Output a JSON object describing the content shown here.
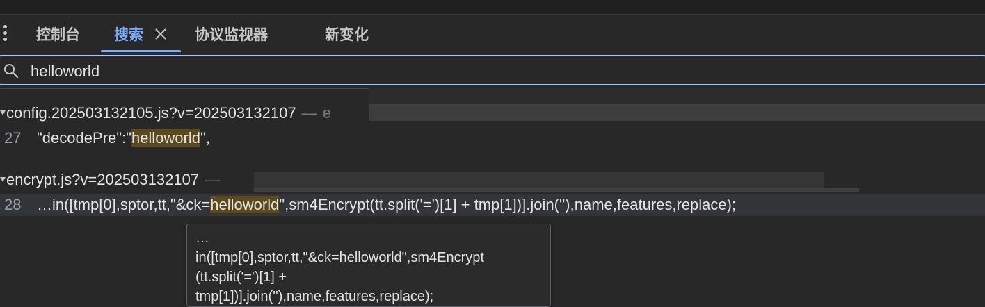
{
  "tabs": [
    {
      "label": "控制台",
      "active": false
    },
    {
      "label": "搜索",
      "active": true
    },
    {
      "label": "协议监视器",
      "active": false
    },
    {
      "label": "新变化",
      "active": false
    }
  ],
  "search": {
    "value": "helloworld"
  },
  "results": [
    {
      "file": "config.202503132105.js?v=202503132107",
      "separator": "—",
      "trailing": "e",
      "matches": [
        {
          "line": "27",
          "before": "\"decodePre\":\"",
          "match": "helloworld",
          "after": "\","
        }
      ]
    },
    {
      "file": "encrypt.js?v=202503132107",
      "separator": "—",
      "matches": [
        {
          "line": "28",
          "before": "…in([tmp[0],sptor,tt,\"&ck=",
          "match": "helloworld",
          "after": "\",sm4Encrypt(tt.split('=')[1] + tmp[1])].join(''),name,features,replace);"
        }
      ]
    }
  ],
  "tooltip": {
    "lines": [
      "…",
      "in([tmp[0],sptor,tt,\"&ck=helloworld\",sm4Encrypt",
      "(tt.split('=')[1] +",
      "tmp[1])].join(''),name,features,replace);"
    ]
  },
  "colors": {
    "accent": "#7cacf8",
    "match_highlight": "#5b4a1b",
    "background": "#282828"
  }
}
